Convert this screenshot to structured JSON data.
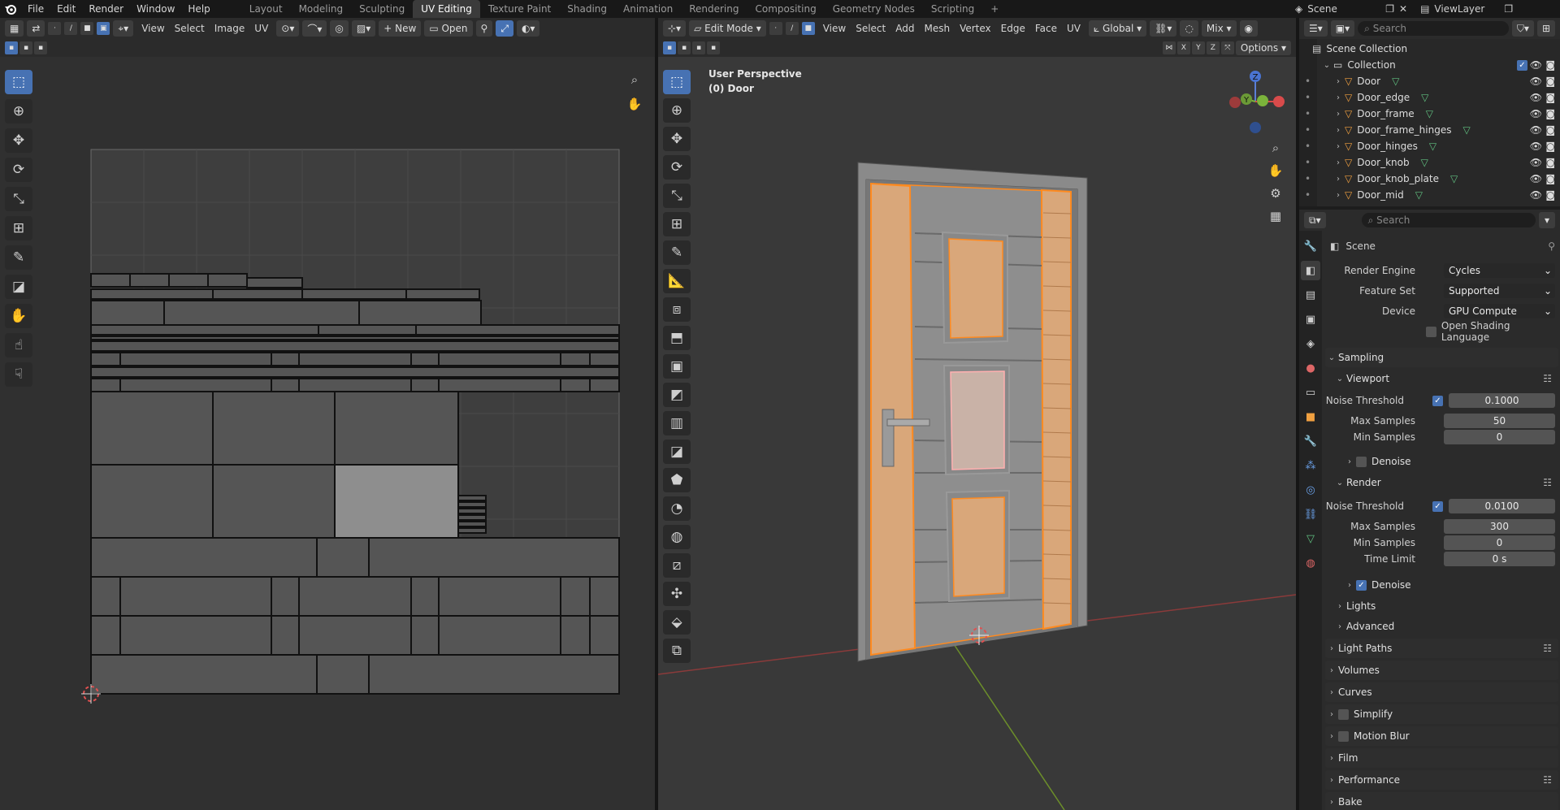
{
  "topbar": {
    "menus": [
      "File",
      "Edit",
      "Render",
      "Window",
      "Help"
    ],
    "workspaces": [
      "Layout",
      "Modeling",
      "Sculpting",
      "UV Editing",
      "Texture Paint",
      "Shading",
      "Animation",
      "Rendering",
      "Compositing",
      "Geometry Nodes",
      "Scripting"
    ],
    "active_workspace": "UV Editing",
    "add_tab": "+",
    "scene_label": "Scene",
    "viewlayer_label": "ViewLayer"
  },
  "uv_editor": {
    "menus": [
      "View",
      "Select",
      "Image",
      "UV"
    ],
    "new_label": "New",
    "open_label": "Open"
  },
  "viewport": {
    "mode_label": "Edit Mode",
    "menus": [
      "View",
      "Select",
      "Add",
      "Mesh",
      "Vertex",
      "Edge",
      "Face",
      "UV"
    ],
    "transform_label": "Global",
    "shading_label": "Mix",
    "axis_x": "X",
    "axis_y": "Y",
    "axis_z": "Z",
    "options_label": "Options",
    "perspective_label": "User Perspective",
    "object_label": "(0) Door",
    "gizmo": {
      "z": "Z",
      "y": "Y"
    }
  },
  "outliner": {
    "search_placeholder": "Search",
    "scene_collection": "Scene Collection",
    "collection": "Collection",
    "objects": [
      "Door",
      "Door_edge",
      "Door_frame",
      "Door_frame_hinges",
      "Door_hinges",
      "Door_knob",
      "Door_knob_plate",
      "Door_mid"
    ]
  },
  "properties": {
    "search_placeholder": "Search",
    "scene_label": "Scene",
    "render_engine": {
      "label": "Render Engine",
      "value": "Cycles"
    },
    "feature_set": {
      "label": "Feature Set",
      "value": "Supported"
    },
    "device": {
      "label": "Device",
      "value": "GPU Compute"
    },
    "osl": {
      "label": "Open Shading Language",
      "checked": false
    },
    "sampling": "Sampling",
    "viewport": {
      "title": "Viewport",
      "noise_threshold": {
        "label": "Noise Threshold",
        "value": "0.1000",
        "checked": true
      },
      "max_samples": {
        "label": "Max Samples",
        "value": "50"
      },
      "min_samples": {
        "label": "Min Samples",
        "value": "0"
      },
      "denoise": {
        "label": "Denoise",
        "checked": false
      }
    },
    "render": {
      "title": "Render",
      "noise_threshold": {
        "label": "Noise Threshold",
        "value": "0.0100",
        "checked": true
      },
      "max_samples": {
        "label": "Max Samples",
        "value": "300"
      },
      "min_samples": {
        "label": "Min Samples",
        "value": "0"
      },
      "time_limit": {
        "label": "Time Limit",
        "value": "0 s"
      },
      "denoise": {
        "label": "Denoise",
        "checked": true
      }
    },
    "lights": "Lights",
    "advanced": "Advanced",
    "panels": [
      "Light Paths",
      "Volumes",
      "Curves",
      "Simplify",
      "Motion Blur",
      "Film",
      "Performance",
      "Bake"
    ]
  },
  "colors": {
    "accent": "#4772b3",
    "selection": "#ff8a1f",
    "background": "#1d1d1d"
  }
}
